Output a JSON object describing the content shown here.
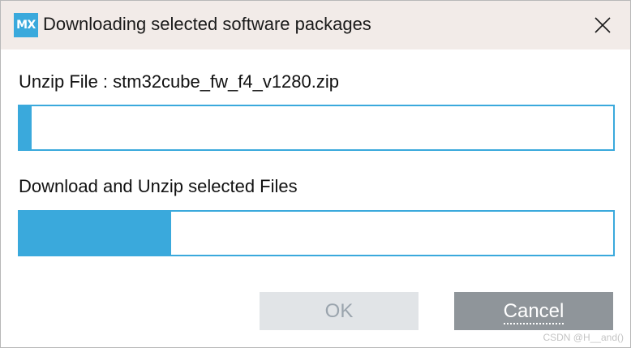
{
  "window": {
    "app_icon_text": "MX",
    "title": "Downloading selected software packages",
    "close_icon": "close-icon"
  },
  "tasks": [
    {
      "label": "Unzip File : stm32cube_fw_f4_v1280.zip",
      "progress": 0.02
    },
    {
      "label": "Download and Unzip selected Files",
      "progress": 0.255
    }
  ],
  "buttons": {
    "ok_label": "OK",
    "ok_enabled": false,
    "cancel_label": "Cancel"
  },
  "watermark": "CSDN @H__and()",
  "colors": {
    "accent": "#3aa9dc",
    "titlebar_bg": "#f2ebe8",
    "cancel_bg": "#8f959a",
    "ok_disabled_bg": "#e1e4e7"
  }
}
